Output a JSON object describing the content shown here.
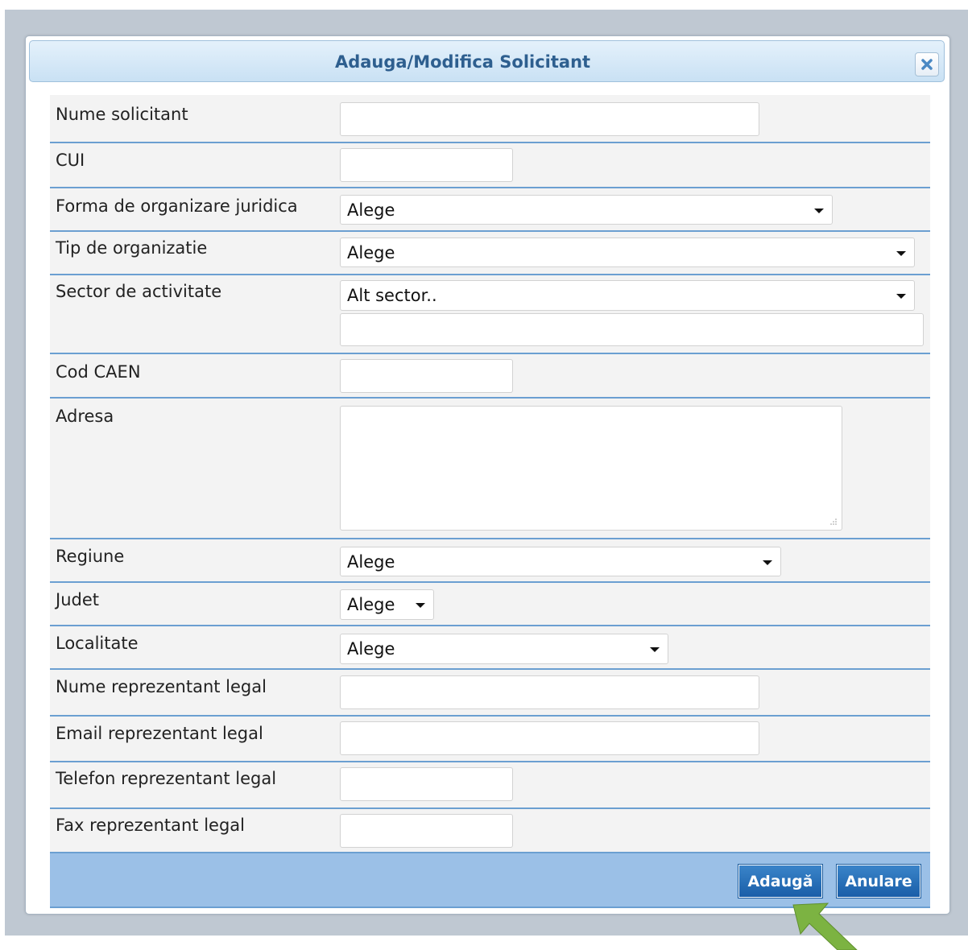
{
  "dialog": {
    "title": "Adauga/Modifica Solicitant",
    "close_icon": "close-x-icon"
  },
  "form": {
    "nume_solicitant": {
      "label": "Nume solicitant",
      "value": ""
    },
    "cui": {
      "label": "CUI",
      "value": ""
    },
    "forma_juridica": {
      "label": "Forma de organizare juridica",
      "selected": "Alege"
    },
    "tip_organizatie": {
      "label": "Tip de organizatie",
      "selected": "Alege"
    },
    "sector_activitate": {
      "label": "Sector de activitate",
      "selected": "Alt sector..",
      "other_value": ""
    },
    "cod_caen": {
      "label": "Cod CAEN",
      "value": ""
    },
    "adresa": {
      "label": "Adresa",
      "value": ""
    },
    "regiune": {
      "label": "Regiune",
      "selected": "Alege"
    },
    "judet": {
      "label": "Judet",
      "selected": "Alege"
    },
    "localitate": {
      "label": "Localitate",
      "selected": "Alege"
    },
    "nume_reprezentant": {
      "label": "Nume reprezentant legal",
      "value": ""
    },
    "email_reprezentant": {
      "label": "Email reprezentant legal",
      "value": ""
    },
    "telefon_reprezentant": {
      "label": "Telefon reprezentant legal",
      "value": ""
    },
    "fax_reprezentant": {
      "label": "Fax reprezentant legal",
      "value": ""
    }
  },
  "footer": {
    "add_label": "Adaugă",
    "cancel_label": "Anulare"
  },
  "colors": {
    "title_text": "#2e5f8f",
    "row_separator": "#6b9fd1",
    "footer_bg": "#9bc0e7",
    "button_bg": "#1a5ea8",
    "arrow": "#7cb342"
  },
  "annotation": {
    "arrow_icon": "pointer-arrow-icon"
  }
}
